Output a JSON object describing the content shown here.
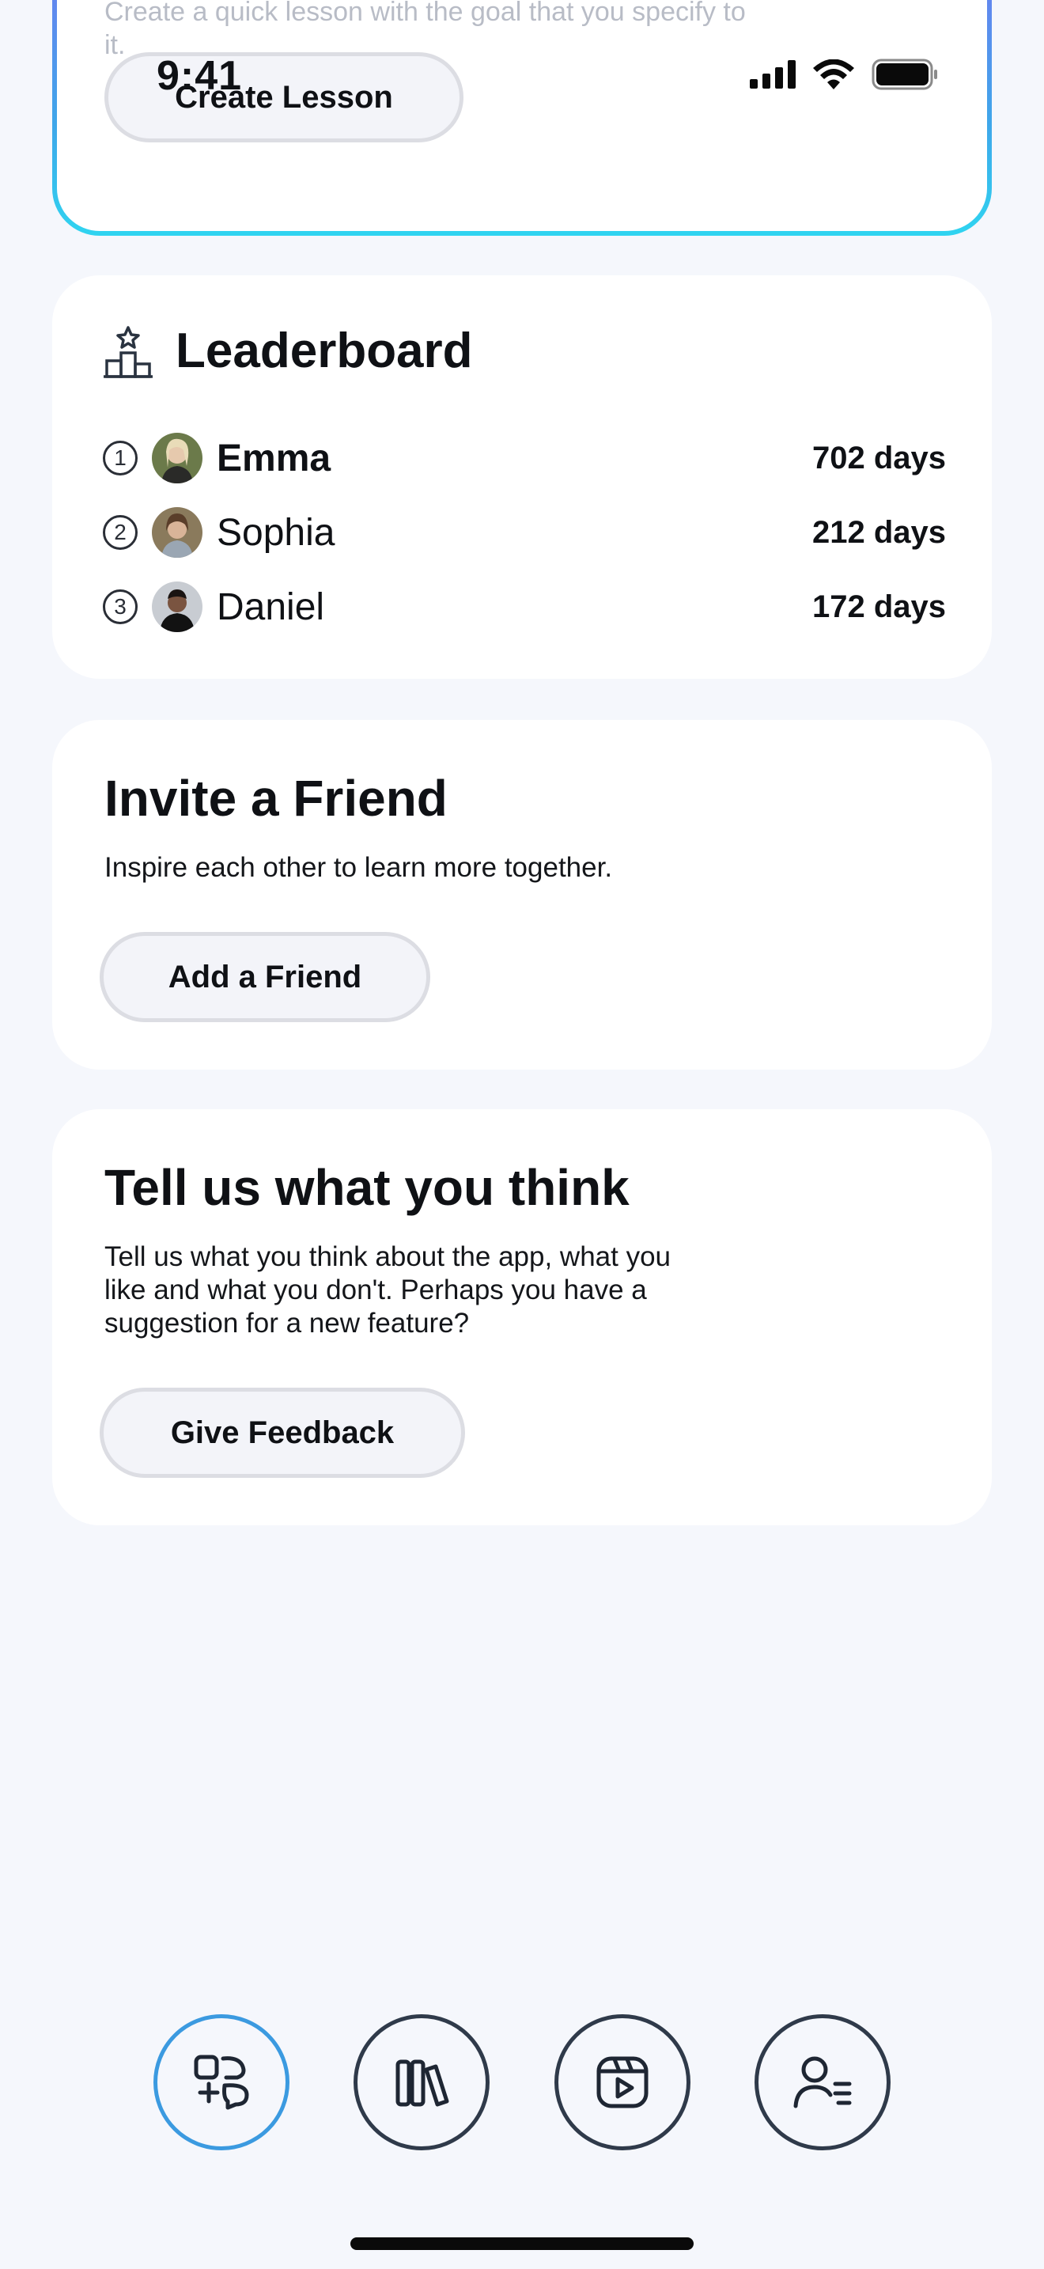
{
  "status_bar": {
    "time": "9:41",
    "icons": [
      "cellular-signal-icon",
      "wifi-icon",
      "battery-icon"
    ]
  },
  "lesson_card": {
    "description": "Create a quick lesson with the goal that you specify to it.",
    "button_label": "Create Lesson"
  },
  "leaderboard": {
    "title": "Leaderboard",
    "icon": "podium-star-icon",
    "entries": [
      {
        "rank": "1",
        "name": "Emma",
        "value": "702 days",
        "highlight": true
      },
      {
        "rank": "2",
        "name": "Sophia",
        "value": "212 days",
        "highlight": false
      },
      {
        "rank": "3",
        "name": "Daniel",
        "value": "172 days",
        "highlight": false
      }
    ]
  },
  "invite": {
    "title": "Invite a Friend",
    "text": "Inspire each other to learn more together.",
    "button_label": "Add a Friend"
  },
  "feedback": {
    "title": "Tell us what you think",
    "text": "Tell us what you think about the app, what you like and what you don't. Perhaps you have a suggestion for a new feature?",
    "button_label": "Give Feedback"
  },
  "bottom_nav": {
    "items": [
      {
        "icon": "learn-chat-icon",
        "active": true
      },
      {
        "icon": "library-icon",
        "active": false
      },
      {
        "icon": "video-icon",
        "active": false
      },
      {
        "icon": "profile-icon",
        "active": false
      }
    ]
  },
  "colors": {
    "background": "#f5f7fc",
    "card": "#ffffff",
    "accent": "#3b9ae0",
    "gradient_top": "#6f7cf0",
    "gradient_bottom": "#2fd4f0",
    "nav_border": "#2f3a4a"
  }
}
